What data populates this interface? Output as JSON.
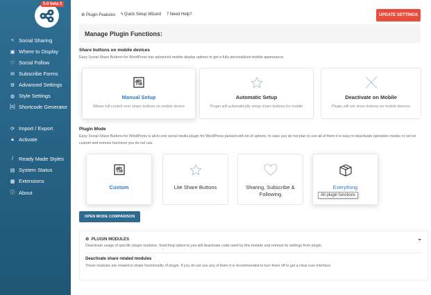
{
  "sidebar": {
    "version_badge": "5.0 beta 2",
    "items": [
      {
        "label": "Social Sharing",
        "icon": "share"
      },
      {
        "label": "Where to Display",
        "icon": "layout"
      },
      {
        "label": "Social Follow",
        "icon": "heart"
      },
      {
        "label": "Subscribe Forms",
        "icon": "mail"
      },
      {
        "label": "Advanced Settings",
        "icon": "gear"
      },
      {
        "label": "Style Settings",
        "icon": "palette"
      },
      {
        "label": "Shortcode Generator",
        "icon": "shortcode"
      },
      {
        "label": "Import / Export",
        "icon": "sync"
      },
      {
        "label": "Activate",
        "icon": "lock"
      },
      {
        "label": "Ready Made Styles",
        "icon": "brush"
      },
      {
        "label": "System Status",
        "icon": "status"
      },
      {
        "label": "Extensions",
        "icon": "gift"
      },
      {
        "label": "About",
        "icon": "info"
      }
    ]
  },
  "header": {
    "links": [
      "Plugin Features",
      "Quick Setup Wizard",
      "Need Help?"
    ],
    "update_button": "UPDATE SETTINGS",
    "title": "Manage Plugin Functions:"
  },
  "mobile": {
    "heading": "Share buttons on mobile devices",
    "desc": "Easy Social Share Buttons for WordPress has advanced mobile display options to get a fully personalized mobile appearance.",
    "options": [
      {
        "title": "Manual Setup",
        "desc": "Allows full control over share buttons on mobile device"
      },
      {
        "title": "Automatic Setup",
        "desc": "Plugin will automatically setup share buttons for mobile"
      },
      {
        "title": "Deactivate on Mobile",
        "desc": "Plugin will not show buttons on mobile devices"
      }
    ]
  },
  "mode": {
    "heading": "Plugin Mode",
    "desc": "Easy Social Share Buttons for WordPress is all-in-one social media plugin for WordPress packed with lot of options. In case you do not plan to use all of them it is easy to deactivate operation modes or set on custom and remove functions you do not use.",
    "options": [
      "Custom",
      "Lite Share Buttons",
      "Sharing, Subscribe & Following",
      "Everything"
    ],
    "tooltip": "All plugin functions",
    "compare_button": "OPEN MODE COMPARISON"
  },
  "modules": {
    "title": "PLUGIN MODULES",
    "desc": "Deactivate usage of specific plugin modules. Switching option to yes will deactivate code used by this module and remove its settings from plugin.",
    "sub_heading": "Deactivate share related modules",
    "sub_desc": "Those modules are related to share functionality of plugin. If you do not use any of them it is recommended to turn them off to get a clear user interface"
  },
  "colors": {
    "accent": "#e74c3c",
    "sidebar": "#2f6f94",
    "link": "#2a78c8"
  }
}
